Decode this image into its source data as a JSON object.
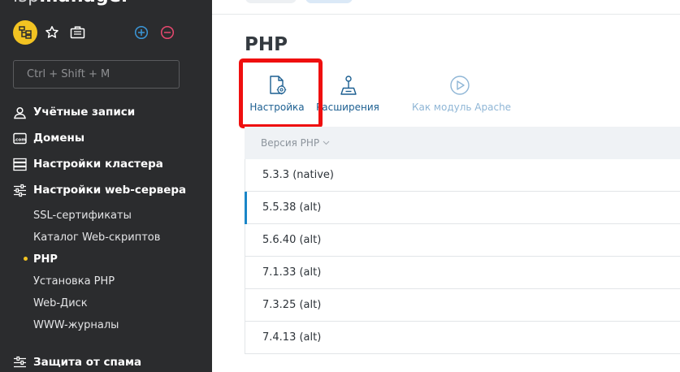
{
  "sidebar": {
    "brand_prefix": "isp",
    "brand_name": "manager",
    "search_placeholder": "Ctrl + Shift + M",
    "accent_color": "#f2c322",
    "sections": [
      {
        "label": "Учётные записи",
        "icon": "user-accounts-icon"
      },
      {
        "label": "Домены",
        "icon": "domains-icon"
      },
      {
        "label": "Настройки кластера",
        "icon": "cluster-icon"
      },
      {
        "label": "Настройки web-сервера",
        "icon": "sliders-icon"
      }
    ],
    "sub_items": [
      {
        "label": "SSL-сертификаты"
      },
      {
        "label": "Каталог Web-скриптов"
      },
      {
        "label": "PHP"
      },
      {
        "label": "Установка PHP"
      },
      {
        "label": "Web-Диск"
      },
      {
        "label": "WWW-журналы"
      }
    ],
    "bottom_section": {
      "label": "Защита от спама",
      "icon": "spam-filter-icon"
    }
  },
  "main": {
    "title": "PHP",
    "toolbar": [
      {
        "label": "Настройка",
        "icon": "settings-file-icon",
        "enabled": true
      },
      {
        "label": "Расширения",
        "icon": "joystick-icon",
        "enabled": true
      },
      {
        "label": "Как модуль Apache",
        "icon": "play-circle-icon",
        "enabled": false
      }
    ],
    "highlight_color": "#ef0f0f",
    "table": {
      "column_header": "Версия PHP",
      "rows": [
        {
          "version": "5.3.3 (native)"
        },
        {
          "version": "5.5.38 (alt)",
          "selected": true
        },
        {
          "version": "5.6.40 (alt)"
        },
        {
          "version": "7.1.33 (alt)"
        },
        {
          "version": "7.3.25 (alt)"
        },
        {
          "version": "7.4.13 (alt)"
        }
      ]
    }
  }
}
